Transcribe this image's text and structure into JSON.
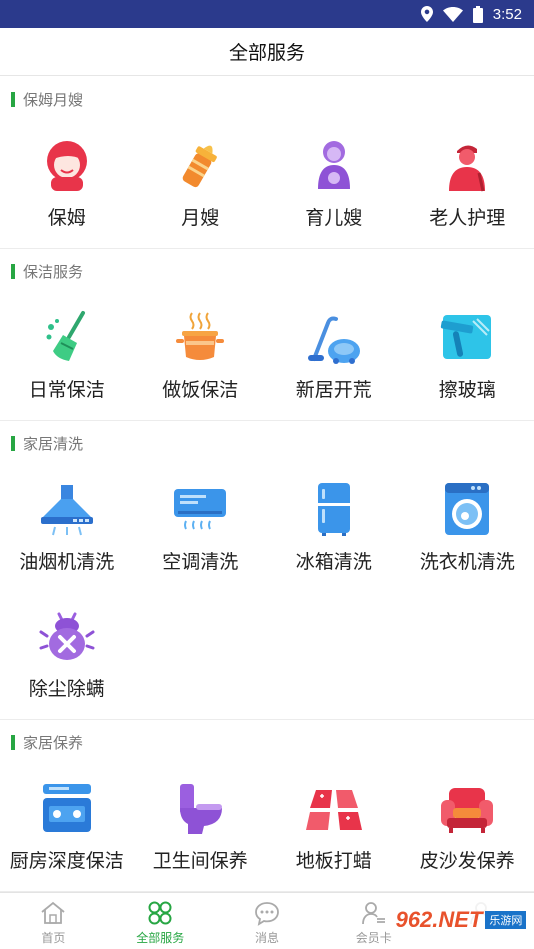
{
  "status_bar": {
    "time": "3:52",
    "icons": [
      "location-icon",
      "wifi-icon",
      "battery-icon"
    ]
  },
  "header": {
    "title": "全部服务"
  },
  "sections": [
    {
      "title": "保姆月嫂",
      "items": [
        {
          "label": "保姆",
          "icon": "nanny-icon"
        },
        {
          "label": "月嫂",
          "icon": "baby-bottle-icon"
        },
        {
          "label": "育儿嫂",
          "icon": "childcare-icon"
        },
        {
          "label": "老人护理",
          "icon": "elderly-care-icon"
        }
      ]
    },
    {
      "title": "保洁服务",
      "items": [
        {
          "label": "日常保洁",
          "icon": "broom-icon"
        },
        {
          "label": "做饭保洁",
          "icon": "cooking-pot-icon"
        },
        {
          "label": "新居开荒",
          "icon": "vacuum-icon"
        },
        {
          "label": "擦玻璃",
          "icon": "window-squeegee-icon"
        }
      ]
    },
    {
      "title": "家居清洗",
      "items": [
        {
          "label": "油烟机清洗",
          "icon": "range-hood-icon"
        },
        {
          "label": "空调清洗",
          "icon": "air-conditioner-icon"
        },
        {
          "label": "冰箱清洗",
          "icon": "fridge-icon"
        },
        {
          "label": "洗衣机清洗",
          "icon": "washing-machine-icon"
        },
        {
          "label": "除尘除螨",
          "icon": "mite-icon"
        }
      ]
    },
    {
      "title": "家居保养",
      "items": [
        {
          "label": "厨房深度保洁",
          "icon": "kitchen-stove-icon"
        },
        {
          "label": "卫生间保养",
          "icon": "toilet-icon"
        },
        {
          "label": "地板打蜡",
          "icon": "floor-tiles-icon"
        },
        {
          "label": "皮沙发保养",
          "icon": "sofa-icon"
        }
      ]
    }
  ],
  "tabs": [
    {
      "label": "首页",
      "icon": "home-icon",
      "active": false
    },
    {
      "label": "全部服务",
      "icon": "clover-icon",
      "active": true
    },
    {
      "label": "消息",
      "icon": "chat-icon",
      "active": false
    },
    {
      "label": "会员卡",
      "icon": "member-icon",
      "active": false
    },
    {
      "label": "",
      "icon": "user-icon",
      "active": false
    }
  ],
  "watermark": {
    "main": "962.NET",
    "sub": "乐游网"
  },
  "colors": {
    "accent": "#27a643",
    "status_bar": "#2b3a8c"
  }
}
